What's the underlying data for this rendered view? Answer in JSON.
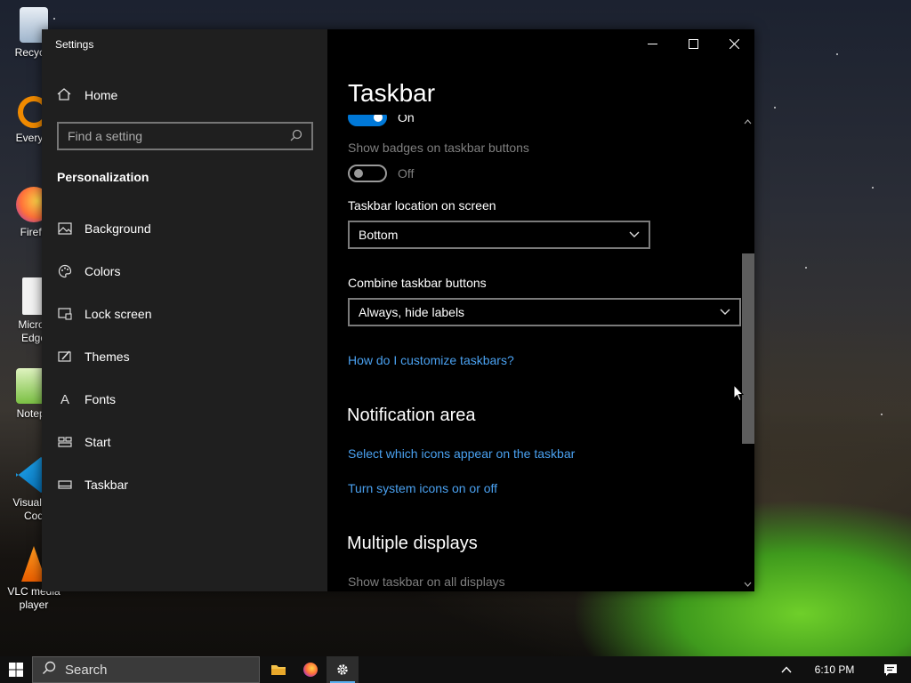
{
  "desktop": {
    "icons": [
      {
        "name": "recycle-bin",
        "label": "Recycle"
      },
      {
        "name": "everything",
        "label": "Everyth"
      },
      {
        "name": "firefox",
        "label": "Firefo"
      },
      {
        "name": "edge",
        "label": "Micros\nEdge"
      },
      {
        "name": "notepad",
        "label": "Notepa"
      },
      {
        "name": "vscode",
        "label": "Visual St\nCod"
      },
      {
        "name": "vlc",
        "label": "VLC media\nplayer"
      }
    ]
  },
  "window": {
    "title": "Settings",
    "caption": {
      "minimize": "—",
      "maximize": "☐",
      "close": "✕"
    }
  },
  "sidebar": {
    "home_label": "Home",
    "search_placeholder": "Find a setting",
    "section_title": "Personalization",
    "items": [
      {
        "label": "Background",
        "icon": "image-icon"
      },
      {
        "label": "Colors",
        "icon": "palette-icon"
      },
      {
        "label": "Lock screen",
        "icon": "lock-screen-icon"
      },
      {
        "label": "Themes",
        "icon": "brush-icon"
      },
      {
        "label": "Fonts",
        "icon": "font-icon"
      },
      {
        "label": "Start",
        "icon": "start-icon"
      },
      {
        "label": "Taskbar",
        "icon": "taskbar-icon"
      }
    ]
  },
  "content": {
    "title": "Taskbar",
    "toggle_on_state": "On",
    "badges_label": "Show badges on taskbar buttons",
    "badges_state": "Off",
    "location_label": "Taskbar location on screen",
    "location_value": "Bottom",
    "combine_label": "Combine taskbar buttons",
    "combine_value": "Always, hide labels",
    "customize_link": "How do I customize taskbars?",
    "notification_heading": "Notification area",
    "select_icons_link": "Select which icons appear on the taskbar",
    "system_icons_link": "Turn system icons on or off",
    "multiple_heading": "Multiple displays",
    "show_all_label": "Show taskbar on all displays"
  },
  "taskbar": {
    "search_label": "Search",
    "time": "6:10 PM"
  },
  "colors": {
    "accent": "#0078d7",
    "link": "#4aa1f0"
  }
}
